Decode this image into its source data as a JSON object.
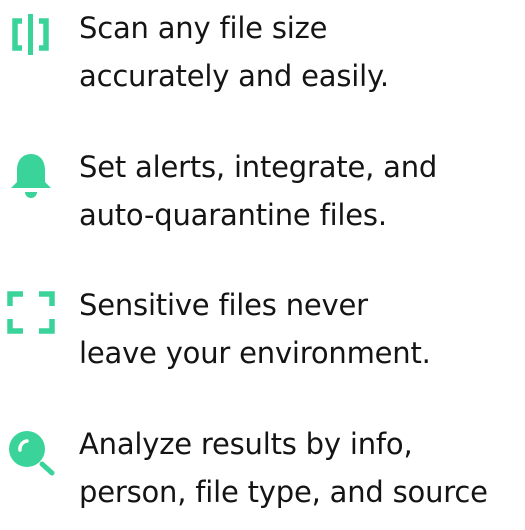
{
  "accent_color": "#3ad39a",
  "features": [
    {
      "icon": "scan-icon",
      "lines": [
        "Scan any file size",
        "accurately and easily."
      ]
    },
    {
      "icon": "bell-icon",
      "lines": [
        "Set alerts, integrate, and",
        "auto-quarantine files."
      ]
    },
    {
      "icon": "frame-corners-icon",
      "lines": [
        "Sensitive files never",
        "leave your environment."
      ]
    },
    {
      "icon": "magnifier-icon",
      "lines": [
        "Analyze results by info,",
        "person, file type, and source"
      ]
    }
  ]
}
